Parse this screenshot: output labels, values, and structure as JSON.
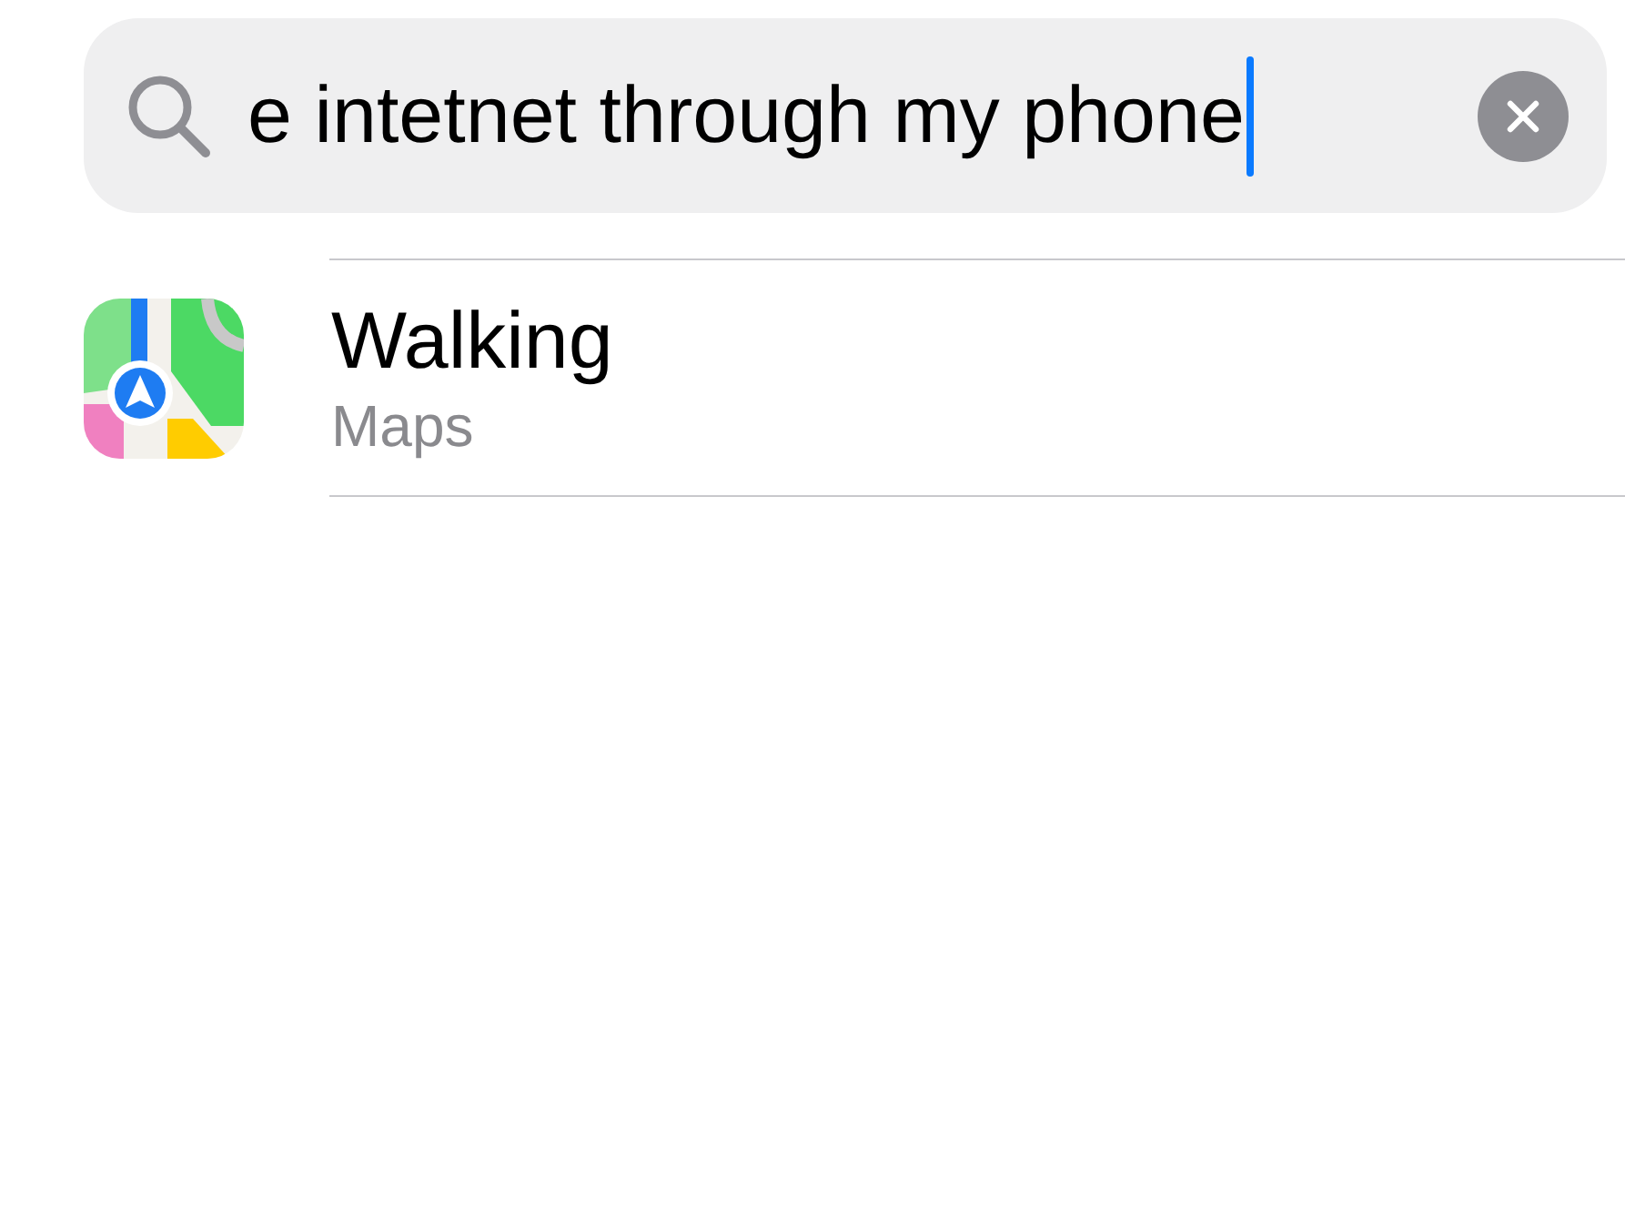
{
  "search": {
    "value": "e intetnet through my phone"
  },
  "results": [
    {
      "title": "Walking",
      "subtitle": "Maps"
    }
  ]
}
